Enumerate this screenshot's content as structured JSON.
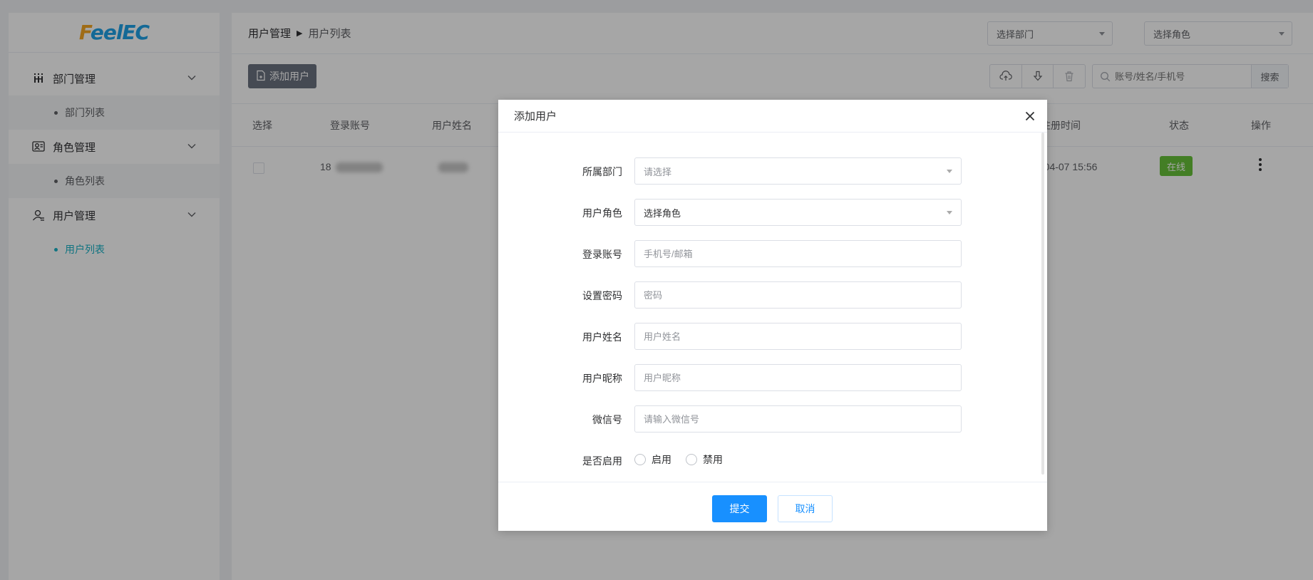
{
  "app": {
    "logo_prefix": "F",
    "logo_rest": "eelEC"
  },
  "sidebar": {
    "groups": [
      {
        "label": "部门管理",
        "icon": "department-icon",
        "items": [
          {
            "label": "部门列表",
            "active": false
          }
        ]
      },
      {
        "label": "角色管理",
        "icon": "role-icon",
        "items": [
          {
            "label": "角色列表",
            "active": false
          }
        ]
      },
      {
        "label": "用户管理",
        "icon": "user-icon",
        "items": [
          {
            "label": "用户列表",
            "active": true
          }
        ]
      }
    ]
  },
  "header": {
    "breadcrumb": [
      "用户管理",
      "用户列表"
    ],
    "dept_select": "选择部门",
    "role_select": "选择角色"
  },
  "toolbar": {
    "add_user": "添加用户",
    "search_placeholder": "账号/姓名/手机号",
    "search_button": "搜索"
  },
  "table": {
    "columns": [
      "选择",
      "登录账号",
      "用户姓名",
      "注册时间",
      "状态",
      "操作"
    ],
    "rows": [
      {
        "account": "18",
        "name": "",
        "registered": "-04-07 15:56",
        "status": "在线"
      }
    ]
  },
  "dialog": {
    "title": "添加用户",
    "fields": [
      {
        "label": "所属部门",
        "placeholder": "请选择",
        "type": "select"
      },
      {
        "label": "用户角色",
        "value": "选择角色",
        "type": "select"
      },
      {
        "label": "登录账号",
        "placeholder": "手机号/邮箱",
        "type": "input"
      },
      {
        "label": "设置密码",
        "placeholder": "密码",
        "type": "input"
      },
      {
        "label": "用户姓名",
        "placeholder": "用户姓名",
        "type": "input"
      },
      {
        "label": "用户昵称",
        "placeholder": "用户昵称",
        "type": "input"
      },
      {
        "label": "微信号",
        "placeholder": "请输入微信号",
        "type": "input"
      }
    ],
    "enable_label": "是否启用",
    "enable_options": [
      "启用",
      "禁用"
    ],
    "submit": "提交",
    "cancel": "取消"
  },
  "colors": {
    "accent": "#19b2c6",
    "primary": "#1890ff",
    "online": "#67c23a",
    "logo": "#1fa2e6"
  }
}
